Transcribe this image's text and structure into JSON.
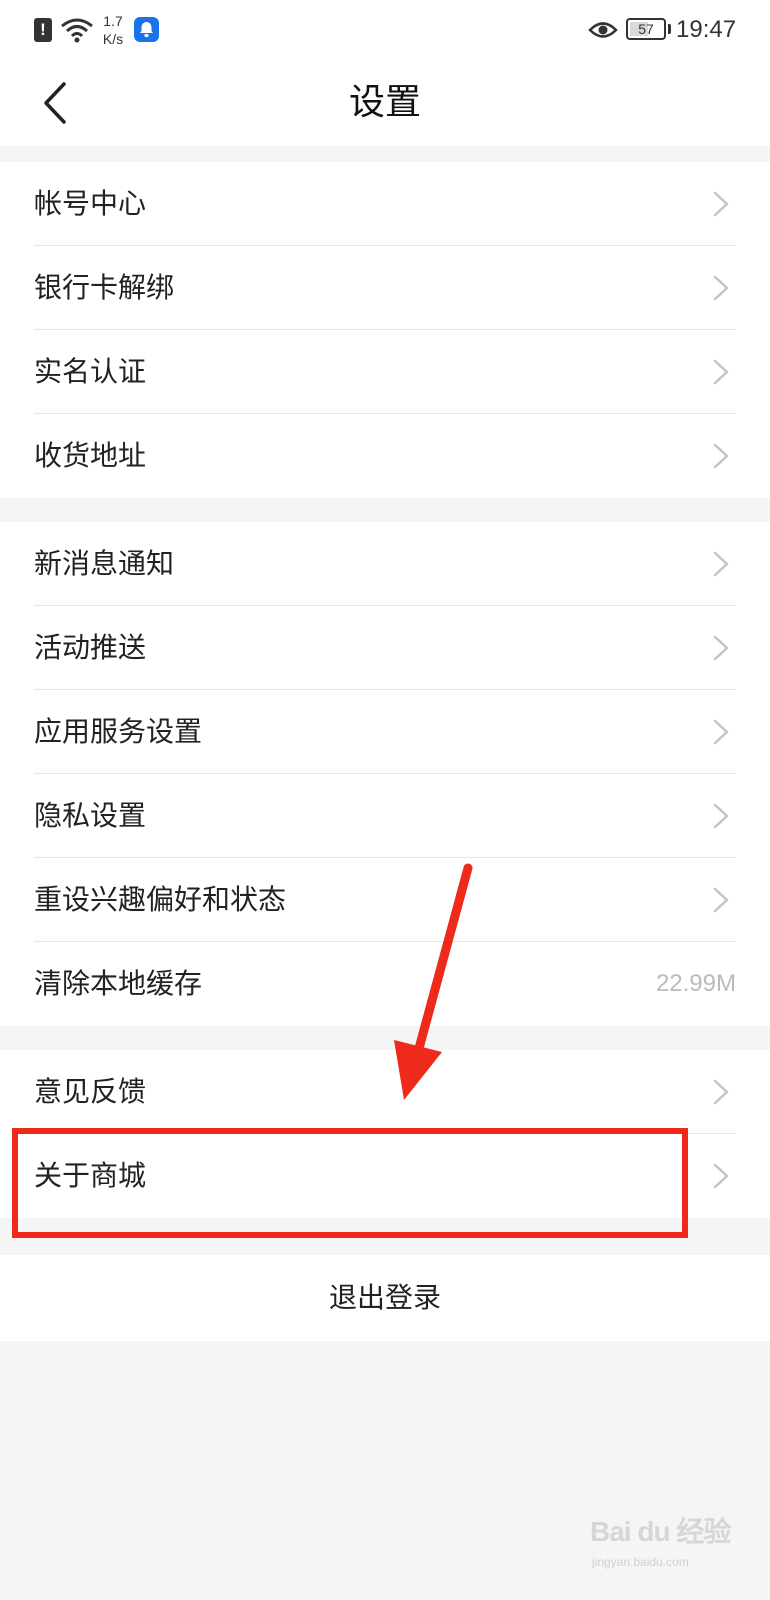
{
  "status_bar": {
    "net_speed_value": "1.7",
    "net_speed_unit": "K/s",
    "battery_level": "57",
    "battery_fraction": 0.57,
    "time": "19:47",
    "icons": [
      "alert-icon",
      "wifi-icon",
      "app-notify-icon",
      "eye-comfort-icon",
      "battery-icon"
    ]
  },
  "nav": {
    "title": "设置",
    "back_icon": "chevron-left-icon"
  },
  "groups": [
    {
      "items": [
        {
          "label": "帐号中心"
        },
        {
          "label": "银行卡解绑"
        },
        {
          "label": "实名认证"
        },
        {
          "label": "收货地址"
        }
      ]
    },
    {
      "items": [
        {
          "label": "新消息通知"
        },
        {
          "label": "活动推送"
        },
        {
          "label": "应用服务设置"
        },
        {
          "label": "隐私设置"
        },
        {
          "label": "重设兴趣偏好和状态"
        },
        {
          "label": "清除本地缓存",
          "value": "22.99M"
        }
      ]
    },
    {
      "items": [
        {
          "label": "意见反馈"
        },
        {
          "label": "关于商城"
        }
      ]
    }
  ],
  "logout_label": "退出登录",
  "watermark": {
    "text": "Bai du 经验",
    "sub": "jingyan.baidu.com"
  },
  "colors": {
    "annotation": "#ee2a1b",
    "background": "#f5f5f5",
    "chevron": "#c4c4c4",
    "cache_value": "#bbbbbb"
  }
}
